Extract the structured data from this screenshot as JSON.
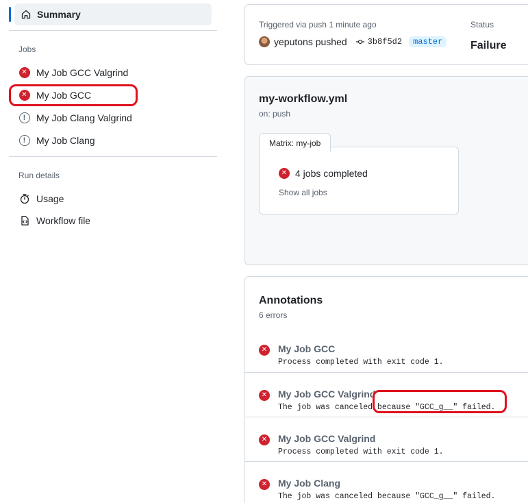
{
  "sidebar": {
    "summary_label": "Summary",
    "jobs_title": "Jobs",
    "jobs": [
      {
        "label": "My Job GCC Valgrind",
        "status": "failure"
      },
      {
        "label": "My Job GCC",
        "status": "failure"
      },
      {
        "label": "My Job Clang Valgrind",
        "status": "warning"
      },
      {
        "label": "My Job Clang",
        "status": "warning"
      }
    ],
    "run_details_title": "Run details",
    "run_details": [
      {
        "label": "Usage",
        "icon": "stopwatch-icon"
      },
      {
        "label": "Workflow file",
        "icon": "file-code-icon"
      }
    ]
  },
  "run_info": {
    "trigger_label": "Triggered via push 1 minute ago",
    "actor": "yeputons pushed",
    "commit": "3b8f5d2",
    "branch": "master",
    "status_label": "Status",
    "status_value": "Failure"
  },
  "workflow": {
    "title": "my-workflow.yml",
    "trigger": "on: push",
    "matrix_tab": "Matrix: my-job",
    "jobs_completed": "4 jobs completed",
    "show_all": "Show all jobs"
  },
  "annotations": {
    "title": "Annotations",
    "count": "6 errors",
    "items": [
      {
        "name": "My Job GCC",
        "message": "Process completed with exit code 1."
      },
      {
        "name": "My Job GCC Valgrind",
        "message": "The job was canceled because \"GCC_g__\" failed."
      },
      {
        "name": "My Job GCC Valgrind",
        "message": "Process completed with exit code 1."
      },
      {
        "name": "My Job Clang",
        "message": "The job was canceled because \"GCC_g__\" failed."
      }
    ]
  },
  "colors": {
    "accent": "#0969da",
    "error": "#cf222e",
    "highlight_outline": "#e0101d"
  }
}
